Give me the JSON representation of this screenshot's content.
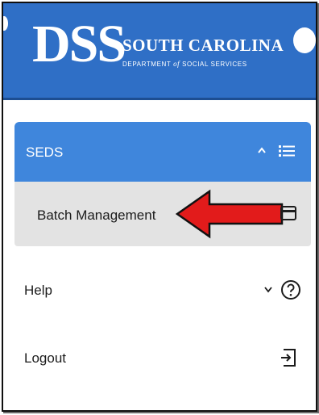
{
  "brand": {
    "logo_text": "DSS",
    "title": "SOUTH CAROLINA",
    "subtitle_pre": "DEPARTMENT",
    "subtitle_of": "of",
    "subtitle_post": "SOCIAL SERVICES",
    "header_color": "#2f6fc6"
  },
  "nav": {
    "section": {
      "label": "SEDS",
      "expanded": true,
      "toggle_icon": "chevron-up-icon",
      "icon": "list-icon",
      "color": "#3f86dc"
    },
    "subitems": [
      {
        "label": "Batch Management",
        "icon": "card-icon",
        "highlighted": true
      }
    ],
    "items": [
      {
        "label": "Help",
        "toggle_icon": "chevron-down-icon",
        "icon": "help-circle-icon"
      },
      {
        "label": "Logout",
        "icon": "logout-icon"
      }
    ]
  },
  "annotation": {
    "type": "red-arrow",
    "color": "#e21b1b",
    "points_to": "Batch Management"
  }
}
